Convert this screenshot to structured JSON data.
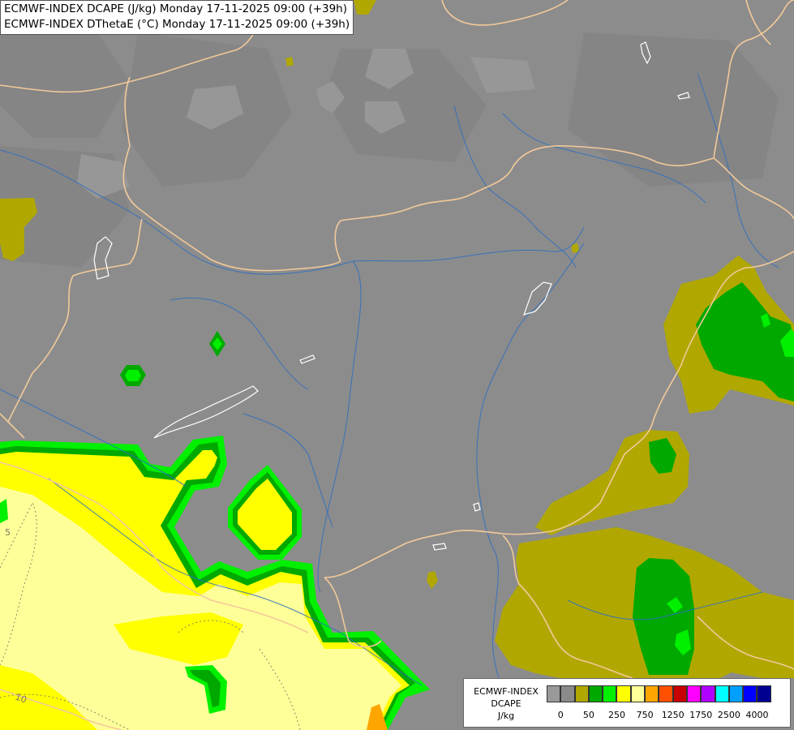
{
  "title": {
    "line1": "ECMWF-INDEX DCAPE (J/kg) Monday 17-11-2025 09:00 (+39h)",
    "line2": "ECMWF-INDEX DThetaE (°C) Monday 17-11-2025 09:00 (+39h)"
  },
  "legend": {
    "title_line1": "ECMWF-INDEX",
    "title_line2": "DCAPE",
    "title_line3": "J/kg",
    "colors": [
      "#999999",
      "#8a8a8a",
      "#b0a800",
      "#00a800",
      "#00f000",
      "#ffff00",
      "#ffff99",
      "#ffa500",
      "#ff5000",
      "#c80000",
      "#ff00ff",
      "#b000ff",
      "#00ffff",
      "#00a0ff",
      "#0000ff",
      "#000090"
    ],
    "ticks": [
      {
        "label": "0"
      },
      {
        "label": "50"
      },
      {
        "label": "250"
      },
      {
        "label": "750"
      },
      {
        "label": "1250"
      },
      {
        "label": "1750"
      },
      {
        "label": "2500"
      },
      {
        "label": "4000"
      }
    ]
  },
  "contour_labels": [
    "5",
    "10"
  ],
  "colors": {
    "background": "#8c8c8c",
    "borders": "#f2c99a",
    "rivers": "#2f6fc0",
    "lakes": "#ffffff",
    "olive": "#b0a800",
    "green": "#00a800",
    "lime": "#00f000",
    "yellow": "#ffff00",
    "light_yellow": "#ffff99",
    "orange": "#ffa500"
  }
}
